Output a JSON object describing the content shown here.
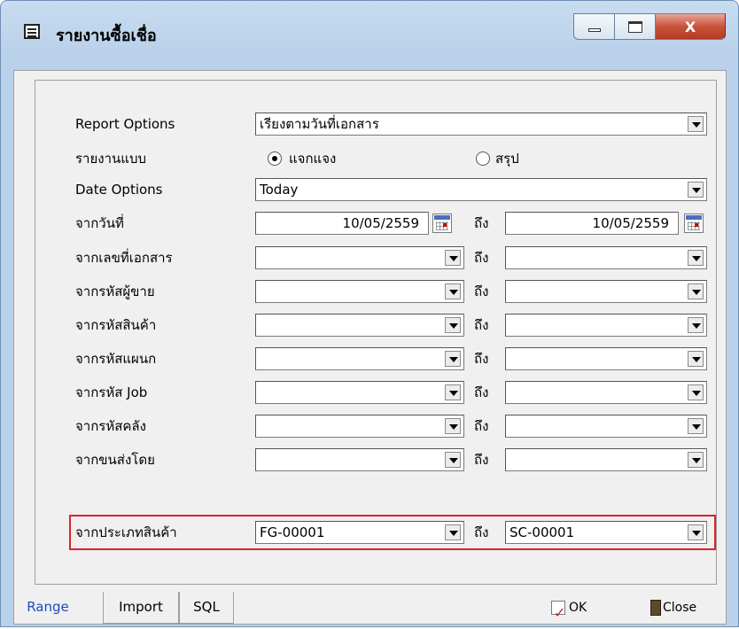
{
  "window": {
    "title": "รายงานซื้อเชื่อ",
    "close_glyph": "X"
  },
  "form": {
    "report_options": {
      "label": "Report Options",
      "value": "เรียงตามวันที่เอกสาร"
    },
    "report_type": {
      "label": "รายงานแบบ",
      "options": [
        {
          "label": "แจกแจง",
          "selected": true
        },
        {
          "label": "สรุป",
          "selected": false
        }
      ]
    },
    "date_options": {
      "label": "Date Options",
      "value": "Today"
    },
    "to_label": "ถึง",
    "date_range": {
      "label": "จากวันที่",
      "from": "10/05/2559",
      "to": "10/05/2559"
    },
    "ranges": [
      {
        "label": "จากเลขที่เอกสาร",
        "from": "",
        "to": ""
      },
      {
        "label": "จากรหัสผู้ขาย",
        "from": "",
        "to": ""
      },
      {
        "label": "จากรหัสสินค้า",
        "from": "",
        "to": ""
      },
      {
        "label": "จากรหัสแผนก",
        "from": "",
        "to": ""
      },
      {
        "label": "จากรหัส Job",
        "from": "",
        "to": ""
      },
      {
        "label": "จากรหัสคลัง",
        "from": "",
        "to": ""
      },
      {
        "label": "จากขนส่งโดย",
        "from": "",
        "to": ""
      },
      {
        "label": "จากประเภทสินค้า",
        "from": "FG-00001",
        "to": "SC-00001"
      }
    ]
  },
  "tabs": [
    {
      "label": "Range",
      "active": true
    },
    {
      "label": "Import",
      "active": false
    },
    {
      "label": "SQL",
      "active": false
    }
  ],
  "buttons": {
    "ok": "OK",
    "close": "Close"
  },
  "colors": {
    "highlight": "#e0212a",
    "active_tab": "#1a4cc0"
  }
}
